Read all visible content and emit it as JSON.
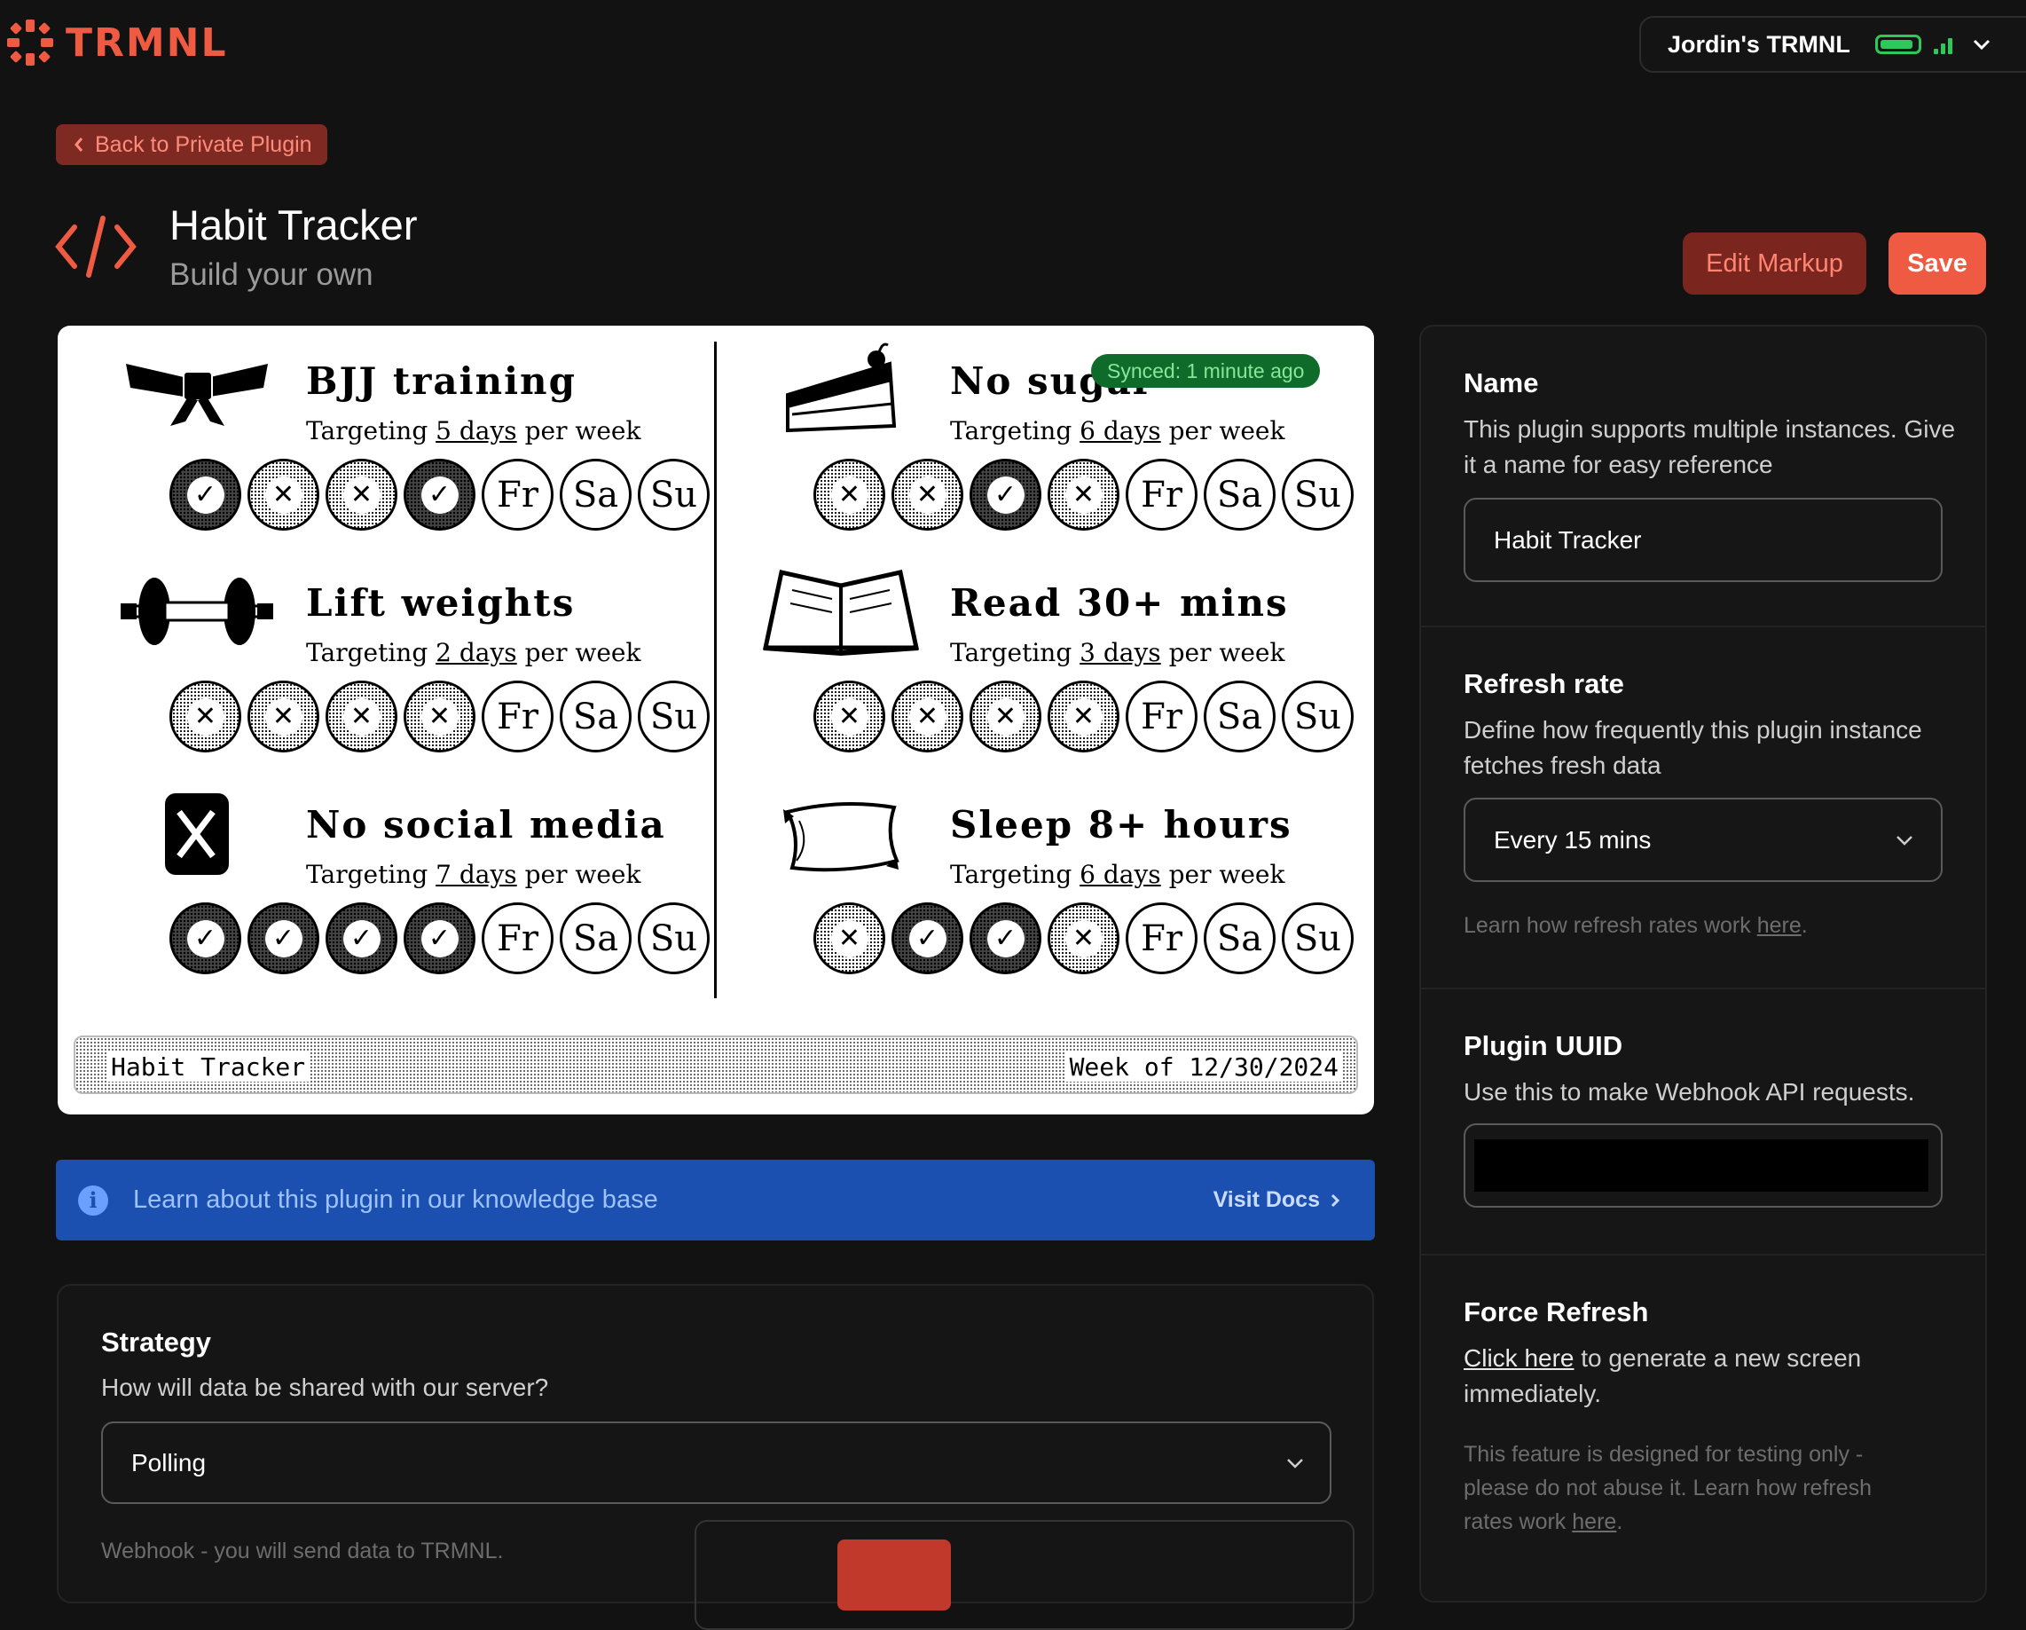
{
  "brand": {
    "name": "TRMNL",
    "accent": "#ef5a42"
  },
  "device": {
    "name": "Jordin's TRMNL",
    "battery_level": 0.9,
    "signal_bars": 3
  },
  "nav": {
    "back_label": "Back to Private Plugin"
  },
  "header": {
    "title": "Habit Tracker",
    "subtitle": "Build your own",
    "edit_label": "Edit Markup",
    "save_label": "Save"
  },
  "preview": {
    "synced": "Synced: 1 minute ago",
    "footer_left": "Habit Tracker",
    "footer_right": "Week of 12/30/2024",
    "target_prefix": "Targeting",
    "target_suffix": "per week",
    "habits": [
      {
        "name": "BJJ training",
        "days": "5 days",
        "icon": "belt-icon",
        "week": [
          "done",
          "miss",
          "miss",
          "done",
          "Fr",
          "Sa",
          "Su"
        ]
      },
      {
        "name": "No sugar",
        "days": "6 days",
        "icon": "cake-icon",
        "week": [
          "miss",
          "miss",
          "done",
          "miss",
          "Fr",
          "Sa",
          "Su"
        ]
      },
      {
        "name": "Lift weights",
        "days": "2 days",
        "icon": "barbell-icon",
        "week": [
          "miss",
          "miss",
          "miss",
          "miss",
          "Fr",
          "Sa",
          "Su"
        ]
      },
      {
        "name": "Read 30+ mins",
        "days": "3 days",
        "icon": "book-icon",
        "week": [
          "miss",
          "miss",
          "miss",
          "miss",
          "Fr",
          "Sa",
          "Su"
        ]
      },
      {
        "name": "No social media",
        "days": "7 days",
        "icon": "x-logo-icon",
        "week": [
          "done",
          "done",
          "done",
          "done",
          "Fr",
          "Sa",
          "Su"
        ]
      },
      {
        "name": "Sleep 8+ hours",
        "days": "6 days",
        "icon": "pillow-icon",
        "week": [
          "miss",
          "done",
          "done",
          "miss",
          "Fr",
          "Sa",
          "Su"
        ]
      }
    ]
  },
  "docs": {
    "text": "Learn about this plugin in our knowledge base",
    "link": "Visit Docs"
  },
  "strategy": {
    "title": "Strategy",
    "desc": "How will data be shared with our server?",
    "value": "Polling",
    "note": "Webhook - you will send data to TRMNL."
  },
  "settings": {
    "name": {
      "title": "Name",
      "desc": "This plugin supports multiple instances. Give it a name for easy reference",
      "value": "Habit Tracker"
    },
    "refresh": {
      "title": "Refresh rate",
      "desc": "Define how frequently this plugin instance fetches fresh data",
      "value": "Every 15 mins",
      "hint": "Learn how refresh rates work ",
      "hint_link": "here",
      "hint_end": "."
    },
    "uuid": {
      "title": "Plugin UUID",
      "desc": "Use this to make Webhook API requests."
    },
    "force": {
      "title": "Force Refresh",
      "link": "Click here",
      "desc": " to generate a new screen immediately.",
      "hint": "This feature is designed for testing only - please do not abuse it. Learn how refresh rates work ",
      "hint_link": "here",
      "hint_end": "."
    }
  }
}
